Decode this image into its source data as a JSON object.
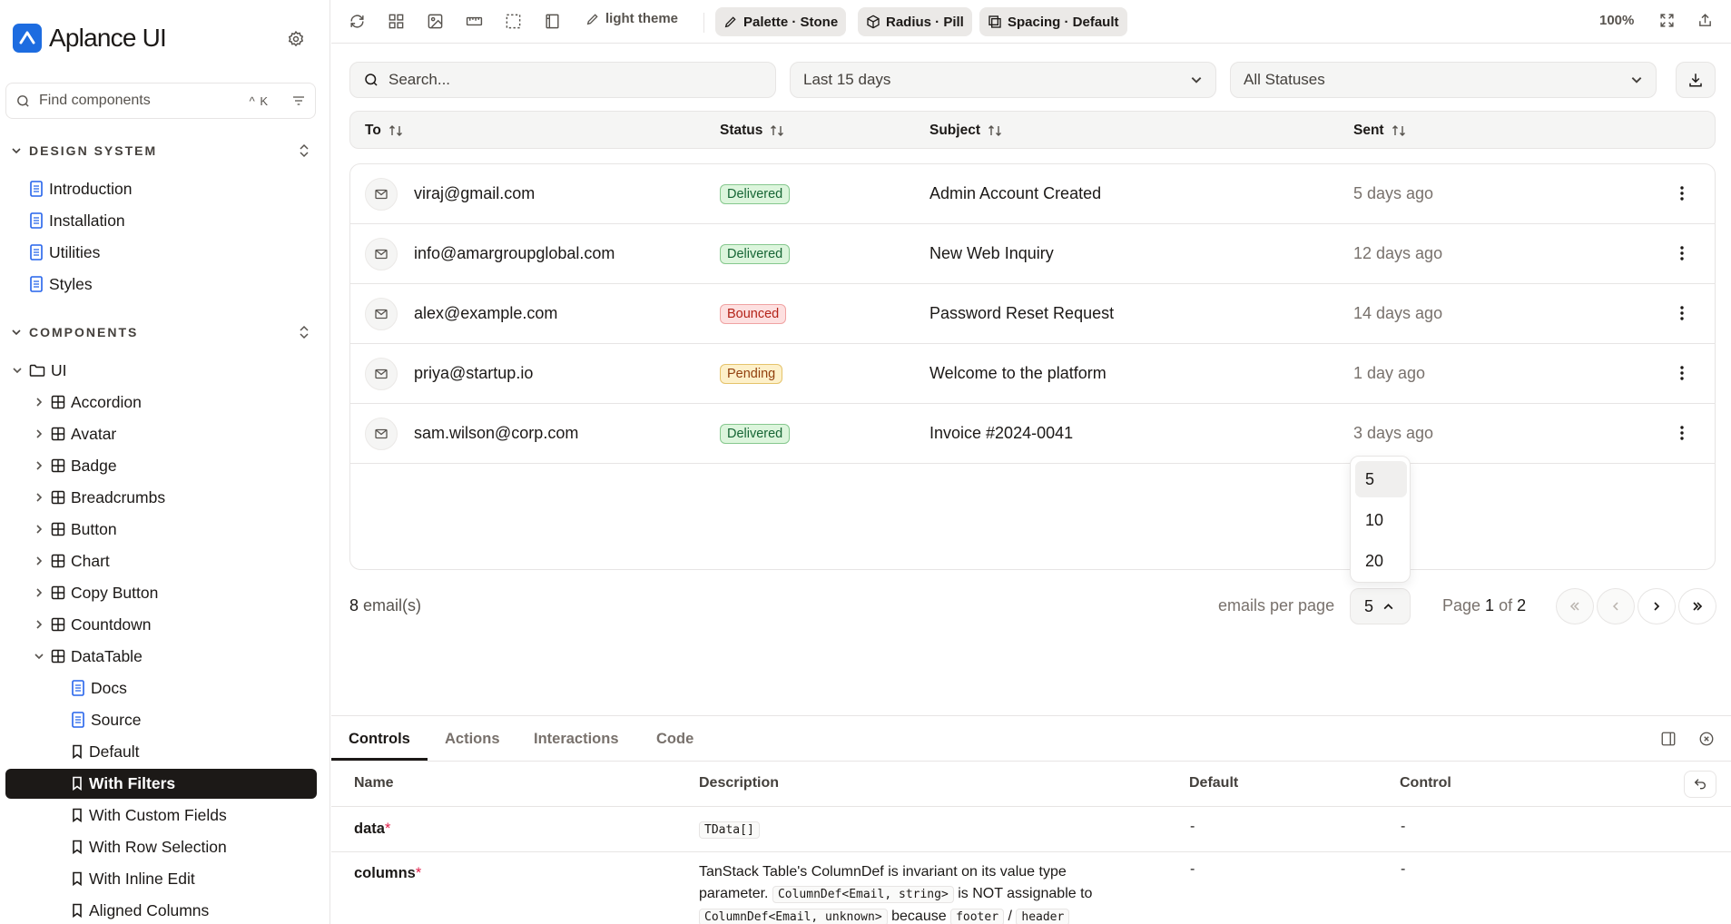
{
  "brand": {
    "name": "Aplance UI"
  },
  "sidebar": {
    "search_placeholder": "Find components",
    "search_shortcut": "^ K",
    "design_system_label": "DESIGN SYSTEM",
    "design_items": [
      "Introduction",
      "Installation",
      "Utilities",
      "Styles"
    ],
    "components_label": "COMPONENTS",
    "ui_folder": "UI",
    "component_items": [
      "Accordion",
      "Avatar",
      "Badge",
      "Breadcrumbs",
      "Button",
      "Chart",
      "Copy Button",
      "Countdown",
      "DataTable"
    ],
    "datatable_children": [
      "Docs",
      "Source",
      "Default",
      "With Filters",
      "With Custom Fields",
      "With Row Selection",
      "With Inline Edit",
      "Aligned Columns"
    ],
    "selected": "With Filters"
  },
  "toolbar": {
    "theme_label": "light theme",
    "palette_label": "Palette · Stone",
    "radius_label": "Radius · Pill",
    "spacing_label": "Spacing · Default",
    "zoom": "100%"
  },
  "filters": {
    "search_placeholder": "Search...",
    "date_range": "Last 15 days",
    "status": "All Statuses"
  },
  "table": {
    "columns": [
      "To",
      "Status",
      "Subject",
      "Sent"
    ],
    "rows": [
      {
        "to": "viraj@gmail.com",
        "status": "Delivered",
        "subject": "Admin Account Created",
        "sent": "5 days ago"
      },
      {
        "to": "info@amargroupglobal.com",
        "status": "Delivered",
        "subject": "New Web Inquiry",
        "sent": "12 days ago"
      },
      {
        "to": "alex@example.com",
        "status": "Bounced",
        "subject": "Password Reset Request",
        "sent": "14 days ago"
      },
      {
        "to": "priya@startup.io",
        "status": "Pending",
        "subject": "Welcome to the platform",
        "sent": "1 day ago"
      },
      {
        "to": "sam.wilson@corp.com",
        "status": "Delivered",
        "subject": "Invoice #2024-0041",
        "sent": "3 days ago"
      }
    ]
  },
  "pager": {
    "count": "8",
    "count_suffix": " email(s)",
    "per_page_label": "emails per page",
    "per_page_value": "5",
    "per_page_options": [
      "5",
      "10",
      "20"
    ],
    "page_word": "Page ",
    "page_current": "1",
    "page_of": " of ",
    "page_total": "2"
  },
  "panel": {
    "tabs": [
      "Controls",
      "Actions",
      "Interactions",
      "Code"
    ],
    "headers": [
      "Name",
      "Description",
      "Default",
      "Control"
    ],
    "props": [
      {
        "name": "data",
        "type": "TData[]",
        "default": "-",
        "control": "-"
      },
      {
        "name": "columns",
        "desc1": "TanStack Table's ColumnDef is invariant on its value type parameter.",
        "code1": "ColumnDef<Email, string>",
        "desc2": " is NOT assignable to",
        "code2": "ColumnDef<Email, unknown>",
        "desc3": " because ",
        "code3": "footer",
        "desc4": " / ",
        "code4": "header",
        "default": "-",
        "control": "-"
      }
    ]
  },
  "colors": {
    "accent": "#1d6ce0",
    "selected_bg": "#1c1917",
    "delivered": "#166534",
    "bounced": "#b42318",
    "pending": "#92400e"
  }
}
